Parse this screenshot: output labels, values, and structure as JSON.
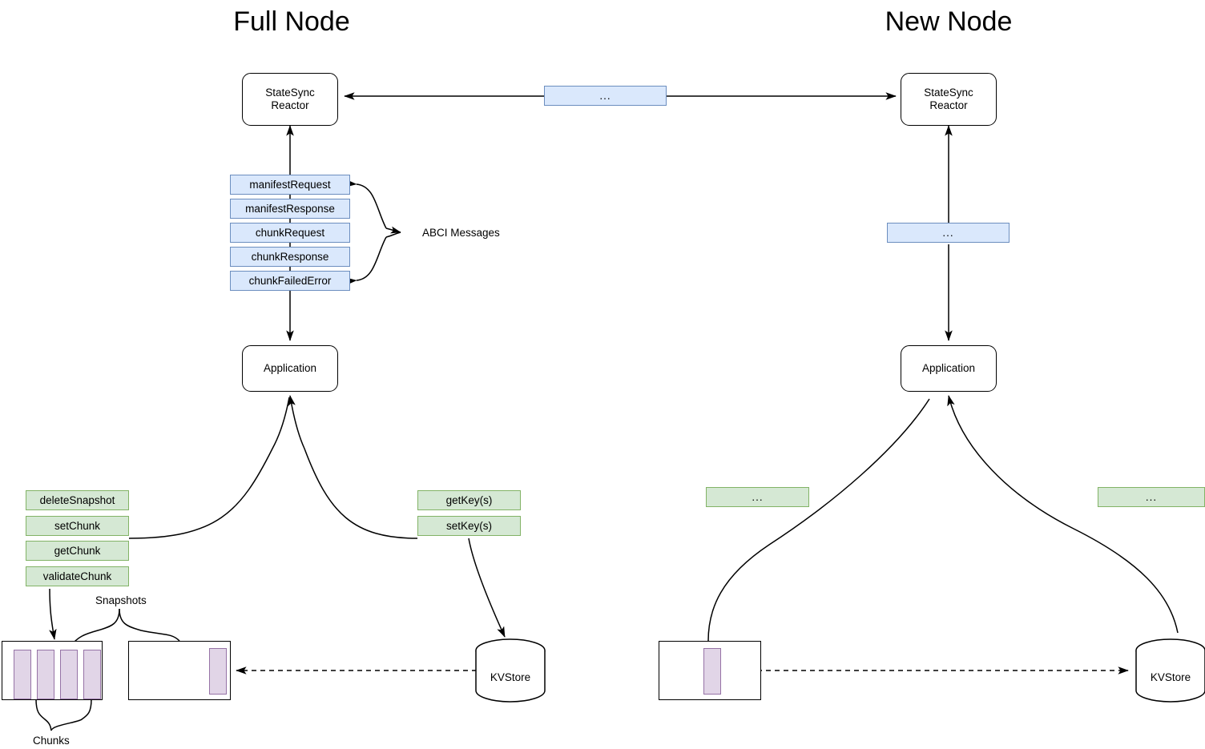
{
  "diagram": {
    "title_left": "Full Node",
    "title_right": "New Node"
  },
  "full_node": {
    "statesync_reactor": "StateSync\nReactor",
    "statesync_reactor_line1": "StateSync",
    "statesync_reactor_line2": "Reactor",
    "application": "Application",
    "abci_messages_label": "ABCI Messages",
    "abci_messages": [
      "manifestRequest",
      "manifestResponse",
      "chunkRequest",
      "chunkResponse",
      "chunkFailedError"
    ],
    "snapshot_api": [
      "deleteSnapshot",
      "setChunk",
      "getChunk",
      "validateChunk"
    ],
    "kv_api": [
      "getKey(s)",
      "setKey(s)"
    ],
    "snapshots_label": "Snapshots",
    "chunks_label": "Chunks",
    "kvstore_label": "KVStore",
    "chunk_count_left": 4,
    "chunk_count_right": 1
  },
  "new_node": {
    "statesync_reactor_line1": "StateSync",
    "statesync_reactor_line2": "Reactor",
    "application": "Application",
    "abci_messages_placeholder": "...",
    "snapshot_api_placeholder": "...",
    "kv_api_placeholder": "...",
    "kvstore_label": "KVStore",
    "chunk_count": 1
  },
  "peer_link": {
    "placeholder": "..."
  },
  "colors": {
    "message_fill": "#dae8fc",
    "message_stroke": "#6c8ebf",
    "api_fill": "#d5e8d4",
    "api_stroke": "#82b366",
    "chunk_fill": "#e1d5e7",
    "chunk_stroke": "#9673a6",
    "line": "#000000",
    "background": "#ffffff"
  }
}
